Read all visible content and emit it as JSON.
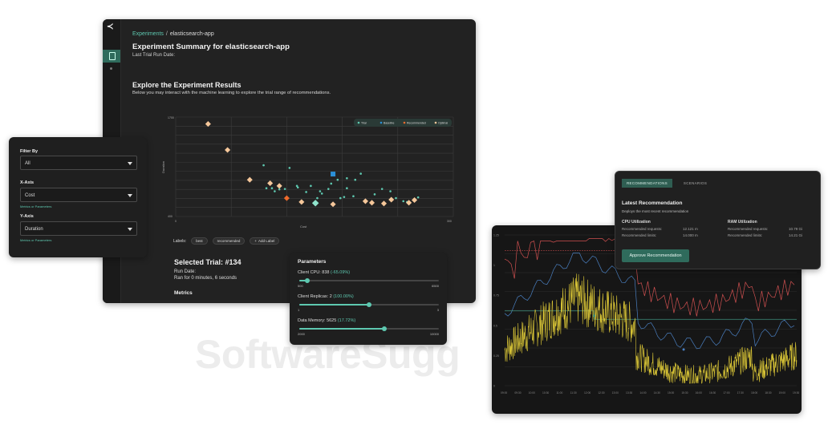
{
  "watermark": "SoftwareSugg",
  "main": {
    "breadcrumb": {
      "root": "Experiments",
      "separator": "/",
      "current": "elasticsearch-app"
    },
    "title": "Experiment Summary for elasticsearch-app",
    "last_run": "Last Trial Run Date:",
    "explore_title": "Explore the Experiment Results",
    "explore_desc": "Below you may interact with the machine learning to explore the trial range of recommendations.",
    "labels_title": "Labels:",
    "label_pills": [
      "best",
      "recommended"
    ],
    "add_label": "Add Label",
    "selected_trial": "Selected Trial: #134",
    "run_date": "Run Date:",
    "ran_for": "Ran for 0 minutes, 6 seconds",
    "metrics": "Metrics"
  },
  "chart_data": [
    {
      "type": "scatter",
      "title": "",
      "xlabel": "Cost",
      "ylabel": "Duration",
      "x_tick_labels": [
        "0",
        "300"
      ],
      "y_tick_labels": [
        "1700",
        "400"
      ],
      "legend": [
        "Trial",
        "Baseline",
        "Recommended",
        "Optimal"
      ],
      "legend_position": "top-right",
      "grid": true,
      "colors": {
        "trial": "#5ec8b0",
        "baseline": "#2b8fd6",
        "recommended": "#ee6a2c",
        "optimal": "#f5c79a"
      },
      "series": [
        {
          "name": "Trial",
          "points": [
            [
              95,
              1070
            ],
            [
              123,
              1035
            ],
            [
              107,
              730
            ],
            [
              98,
              770
            ],
            [
              104,
              770
            ],
            [
              112,
              755
            ],
            [
              118,
              760
            ],
            [
              132,
              780
            ],
            [
              146,
              800
            ],
            [
              141,
              720
            ],
            [
              153,
              640
            ],
            [
              156,
              730
            ],
            [
              158,
              700
            ],
            [
              165,
              760
            ],
            [
              168,
              830
            ],
            [
              175,
              880
            ],
            [
              185,
              770
            ],
            [
              194,
              880
            ],
            [
              178,
              640
            ],
            [
              182,
              655
            ],
            [
              192,
              665
            ],
            [
              215,
              690
            ],
            [
              223,
              760
            ],
            [
              232,
              730
            ],
            [
              238,
              640
            ],
            [
              246,
              600
            ],
            [
              250,
              590
            ],
            [
              258,
              610
            ],
            [
              262,
              650
            ],
            [
              185,
              900
            ],
            [
              200,
              960
            ],
            [
              131,
              800
            ]
          ]
        },
        {
          "name": "Baseline",
          "points": [
            [
              170,
              955
            ]
          ]
        },
        {
          "name": "Recommended",
          "points": [
            [
              120,
              640
            ]
          ]
        },
        {
          "name": "Optimal",
          "points": [
            [
              35,
              1610
            ],
            [
              56,
              1270
            ],
            [
              80,
              880
            ],
            [
              102,
              835
            ],
            [
              112,
              800
            ],
            [
              136,
              590
            ],
            [
              170,
              560
            ],
            [
              205,
              600
            ],
            [
              212,
              580
            ],
            [
              225,
              570
            ],
            [
              233,
              620
            ],
            [
              252,
              580
            ],
            [
              258,
              615
            ]
          ]
        }
      ]
    },
    {
      "type": "line",
      "title": "",
      "xlabel": "",
      "ylabel": "",
      "colors": {
        "cpu_usage": "#d8c436",
        "limit": "#d05050",
        "request": "#4a7fc0",
        "recommended": "#3f8f7c"
      }
    }
  ],
  "filter": {
    "filter_by_label": "Filter By",
    "filter_by_value": "All",
    "x_axis_label": "X-Axis",
    "x_axis_value": "Cost",
    "x_hint": "Metrics or Parameters",
    "y_axis_label": "Y-Axis",
    "y_axis_value": "Duration",
    "y_hint": "Metrics or Parameters"
  },
  "params": {
    "title": "Parameters",
    "items": [
      {
        "label": "Client CPU: 838",
        "pct": "(-65.09%)",
        "min": "500",
        "max": "6500",
        "fill": 0.06
      },
      {
        "label": "Client Replicas: 2",
        "pct": "(100.00%)",
        "min": "1",
        "max": "3",
        "fill": 0.5
      },
      {
        "label": "Data Memory: 5625",
        "pct": "(17.72%)",
        "min": "2000",
        "max": "10000",
        "fill": 0.61
      }
    ]
  },
  "recommendations": {
    "tabs": [
      "RECOMMENDATIONS",
      "SCENARIOS"
    ],
    "title": "Latest Recommendation",
    "subtitle": "Deploys the most recent recommendation",
    "cpu_title": "CPU Utilization",
    "ram_title": "RAM Utilization",
    "cpu_requests_label": "Recommended requests:",
    "cpu_requests_value": "12.121 m",
    "cpu_limits_label": "Recommended limits:",
    "cpu_limits_value": "14.000 m",
    "ram_requests_label": "Recommended requests:",
    "ram_requests_value": "10.79 Gi",
    "ram_limits_label": "Recommended limits:",
    "ram_limits_value": "14.21 Gi",
    "approve_label": "Approve Recommendation"
  },
  "timeseries": {
    "y_ticks": [
      "1.25",
      "1",
      "0.75",
      "0.5",
      "0.25",
      "0"
    ],
    "x_ticks": [
      "09:00",
      "09:30",
      "10:00",
      "10:30",
      "11:00",
      "11:30",
      "12:00",
      "12:30",
      "13:00",
      "13:30",
      "14:00",
      "14:30",
      "15:00",
      "15:30",
      "16:00",
      "16:30",
      "17:00",
      "17:30",
      "18:00",
      "18:30",
      "19:00",
      "19:30"
    ]
  }
}
